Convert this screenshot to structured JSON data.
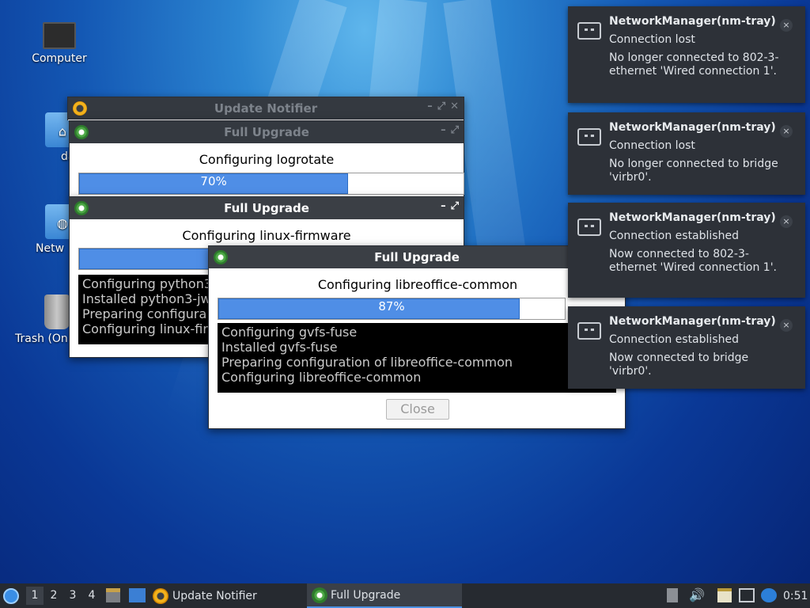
{
  "desktop": {
    "icons": [
      {
        "label": "Computer",
        "icon": "computer-icon"
      },
      {
        "label": "dart",
        "icon": "home-folder-icon"
      },
      {
        "label": "Netw",
        "icon": "network-folder-icon"
      },
      {
        "label": "Trash (On",
        "icon": "trash-icon"
      }
    ]
  },
  "windows": {
    "update_notifier": {
      "title": "Update Notifier"
    },
    "upgrade1": {
      "title": "Full Upgrade",
      "task": "Configuring logrotate",
      "percent": "70%",
      "fraction": 0.7
    },
    "upgrade2": {
      "title": "Full Upgrade",
      "task": "Configuring linux-firmware",
      "log": [
        "Configuring python3",
        "Installed python3-jw",
        "Preparing configura",
        "Configuring linux-fir"
      ]
    },
    "upgrade3": {
      "title": "Full Upgrade",
      "task": "Configuring libreoffice-common",
      "percent": "87%",
      "fraction": 0.87,
      "log": [
        "Configuring gvfs-fuse",
        "Installed gvfs-fuse",
        "Preparing configuration of libreoffice-common",
        "Configuring libreoffice-common"
      ],
      "close_label": "Close"
    }
  },
  "notifications": [
    {
      "app": "NetworkManager(nm-tray)",
      "summary": "Connection lost",
      "body": "No longer connected to 802-3-ethernet 'Wired connection 1'."
    },
    {
      "app": "NetworkManager(nm-tray)",
      "summary": "Connection lost",
      "body": "No longer connected to bridge 'virbr0'."
    },
    {
      "app": "NetworkManager(nm-tray)",
      "summary": "Connection established",
      "body": "Now connected to 802-3-ethernet 'Wired connection 1'."
    },
    {
      "app": "NetworkManager(nm-tray)",
      "summary": "Connection established",
      "body": "Now connected to bridge 'virbr0'."
    }
  ],
  "notification_close": "×",
  "taskbar": {
    "workspaces": [
      "1",
      "2",
      "3",
      "4"
    ],
    "tasks": [
      {
        "label": "Update Notifier",
        "icon": "update-notifier-icon"
      },
      {
        "label": "Full Upgrade",
        "icon": "gear-icon"
      }
    ],
    "clock": "0:51"
  },
  "window_controls": {
    "minimize": "–",
    "maximize": "⤢",
    "close": "✕"
  }
}
